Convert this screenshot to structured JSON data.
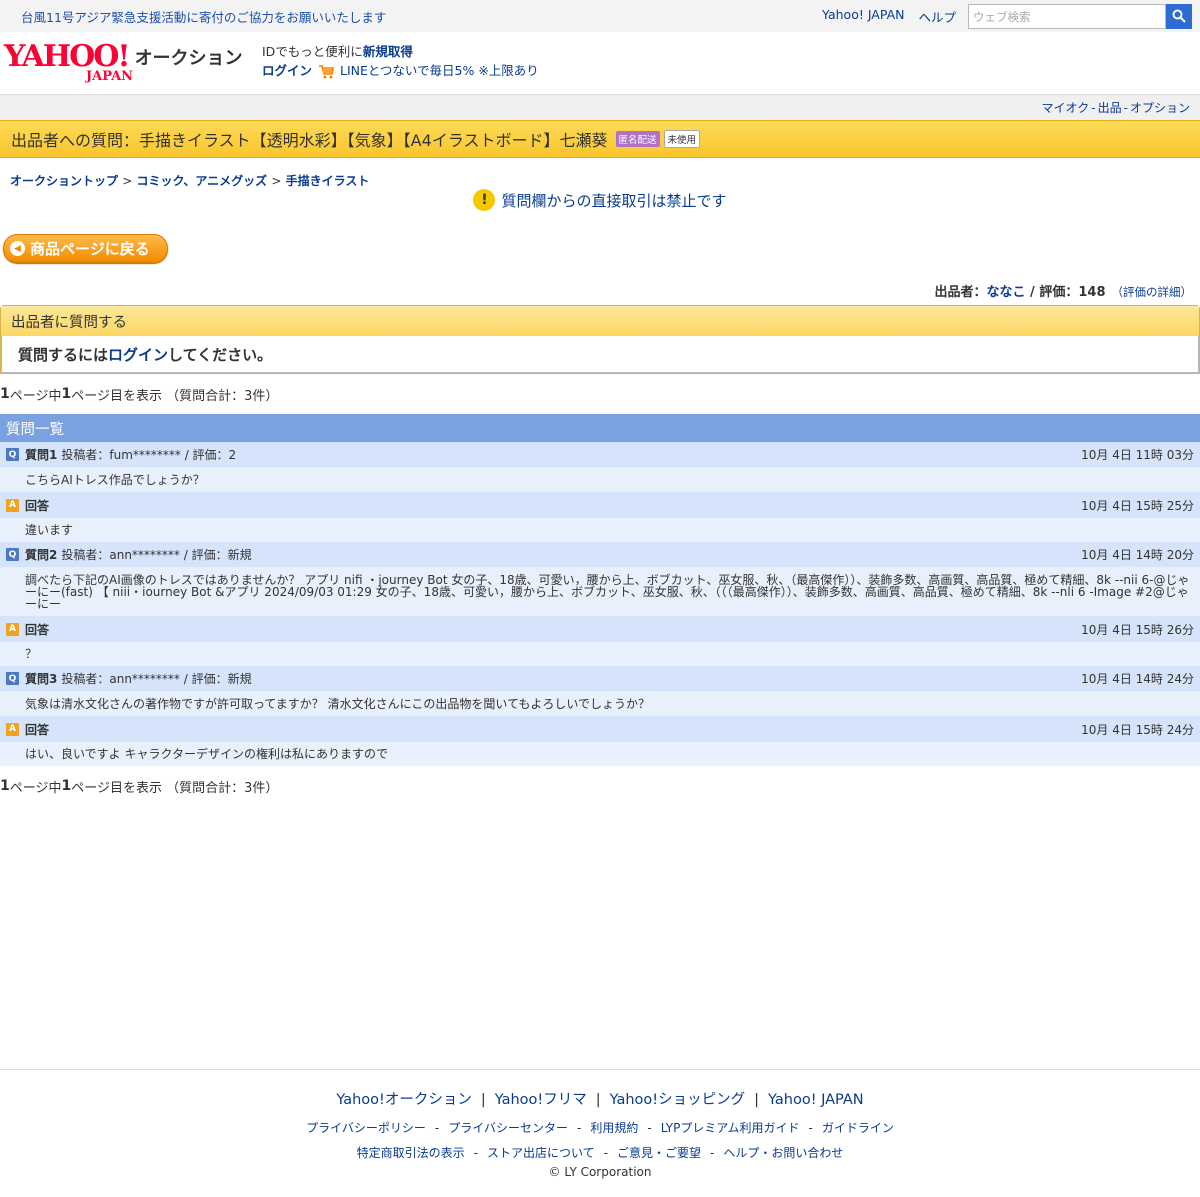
{
  "topbar": {
    "notice": "台風11号アジア緊急支援活動に寄付のご協力をお願いいたします",
    "links": [
      "Yahoo! JAPAN",
      "ヘルプ"
    ],
    "search_placeholder": "ウェブ検索"
  },
  "header": {
    "logo_text": "YAHOO!",
    "logo_sub": "JAPAN",
    "service_name": "オークション",
    "id_text": "IDでもっと便利に",
    "register_link": "新規取得",
    "login_link": "ログイン",
    "line_promo": "LINEとつないで毎日5% ※上限あり"
  },
  "optbar": {
    "links": [
      "マイオク",
      "出品",
      "オプション"
    ],
    "sep": "-"
  },
  "title": {
    "text": "出品者への質問：手描きイラスト【透明水彩】【気象】【A4イラストボード】七瀬葵",
    "badge_anon": "匿名配送",
    "badge_unused": "未使用"
  },
  "breadcrumb": {
    "items": [
      "オークショントップ",
      "コミック、アニメグッズ",
      "手描きイラスト"
    ],
    "sep": ">"
  },
  "warning": "質問欄からの直接取引は禁止です",
  "back_button": "商品ページに戻る",
  "seller": {
    "label": "出品者：",
    "name": "ななこ",
    "slash": " / ",
    "rating_label": "評価：",
    "rating": "148",
    "detail": "（評価の詳細）"
  },
  "ask": {
    "heading": "出品者に質問する",
    "prefix": "質問するには",
    "login": "ログイン",
    "suffix": "してください。"
  },
  "pageinfo": {
    "total_pages": "1",
    "mid": "ページ中",
    "current": "1",
    "tail": "ページ目を表示 （質問合計：3件）"
  },
  "questions": {
    "heading": "質問一覧",
    "items": [
      {
        "label": "質問1",
        "meta": "投稿者：fum******** / 評価：2",
        "date": "10月 4日 11時 03分",
        "text": "こちらAIトレス作品でしょうか？",
        "answer_label": "回答",
        "answer_date": "10月 4日 15時 25分",
        "answer_text": "違います"
      },
      {
        "label": "質問2",
        "meta": "投稿者：ann******** / 評価：新規",
        "date": "10月 4日 14時 20分",
        "text": "調べたら下記のAI画像のトレスではありませんか？ アプリ nifi ・journey Bot 女の子、18歳、可愛い，腰から上、ボブカット、巫女服、秋、（最高傑作））、装飾多数、高画質、高品質、極めて精細、8k --nii 6-@じゃーにー(fast) 【 niii・iourney Bot &アプリ 2024/09/03 01:29 女の子、18歳、可愛い，腰から上、ボブカット、巫女服、秋、（（（最高傑作））、装飾多数、高画質、高品質、極めて精細、8k --nli 6 -Image #2@じゃーにー",
        "answer_label": "回答",
        "answer_date": "10月 4日 15時 26分",
        "answer_text": "？"
      },
      {
        "label": "質問3",
        "meta": "投稿者：ann******** / 評価：新規",
        "date": "10月 4日 14時 24分",
        "text": "気象は清水文化さんの著作物ですが許可取ってますか？ 清水文化さんにこの出品物を聞いてもよろしいでしょうか？",
        "answer_label": "回答",
        "answer_date": "10月 4日 15時 24分",
        "answer_text": "はい、良いですよ キャラクターデザインの権利は私にありますので"
      }
    ]
  },
  "footer": {
    "main_links": [
      "Yahoo!オークション",
      "Yahoo!フリマ",
      "Yahoo!ショッピング",
      "Yahoo! JAPAN"
    ],
    "sub_links_1": [
      "プライバシーポリシー",
      "プライバシーセンター",
      "利用規約",
      "LYPプレミアム利用ガイド",
      "ガイドライン"
    ],
    "sub_links_2": [
      "特定商取引法の表示",
      "ストア出店について",
      "ご意見・ご要望",
      "ヘルプ・お問い合わせ"
    ],
    "copyright": "© LY Corporation"
  }
}
